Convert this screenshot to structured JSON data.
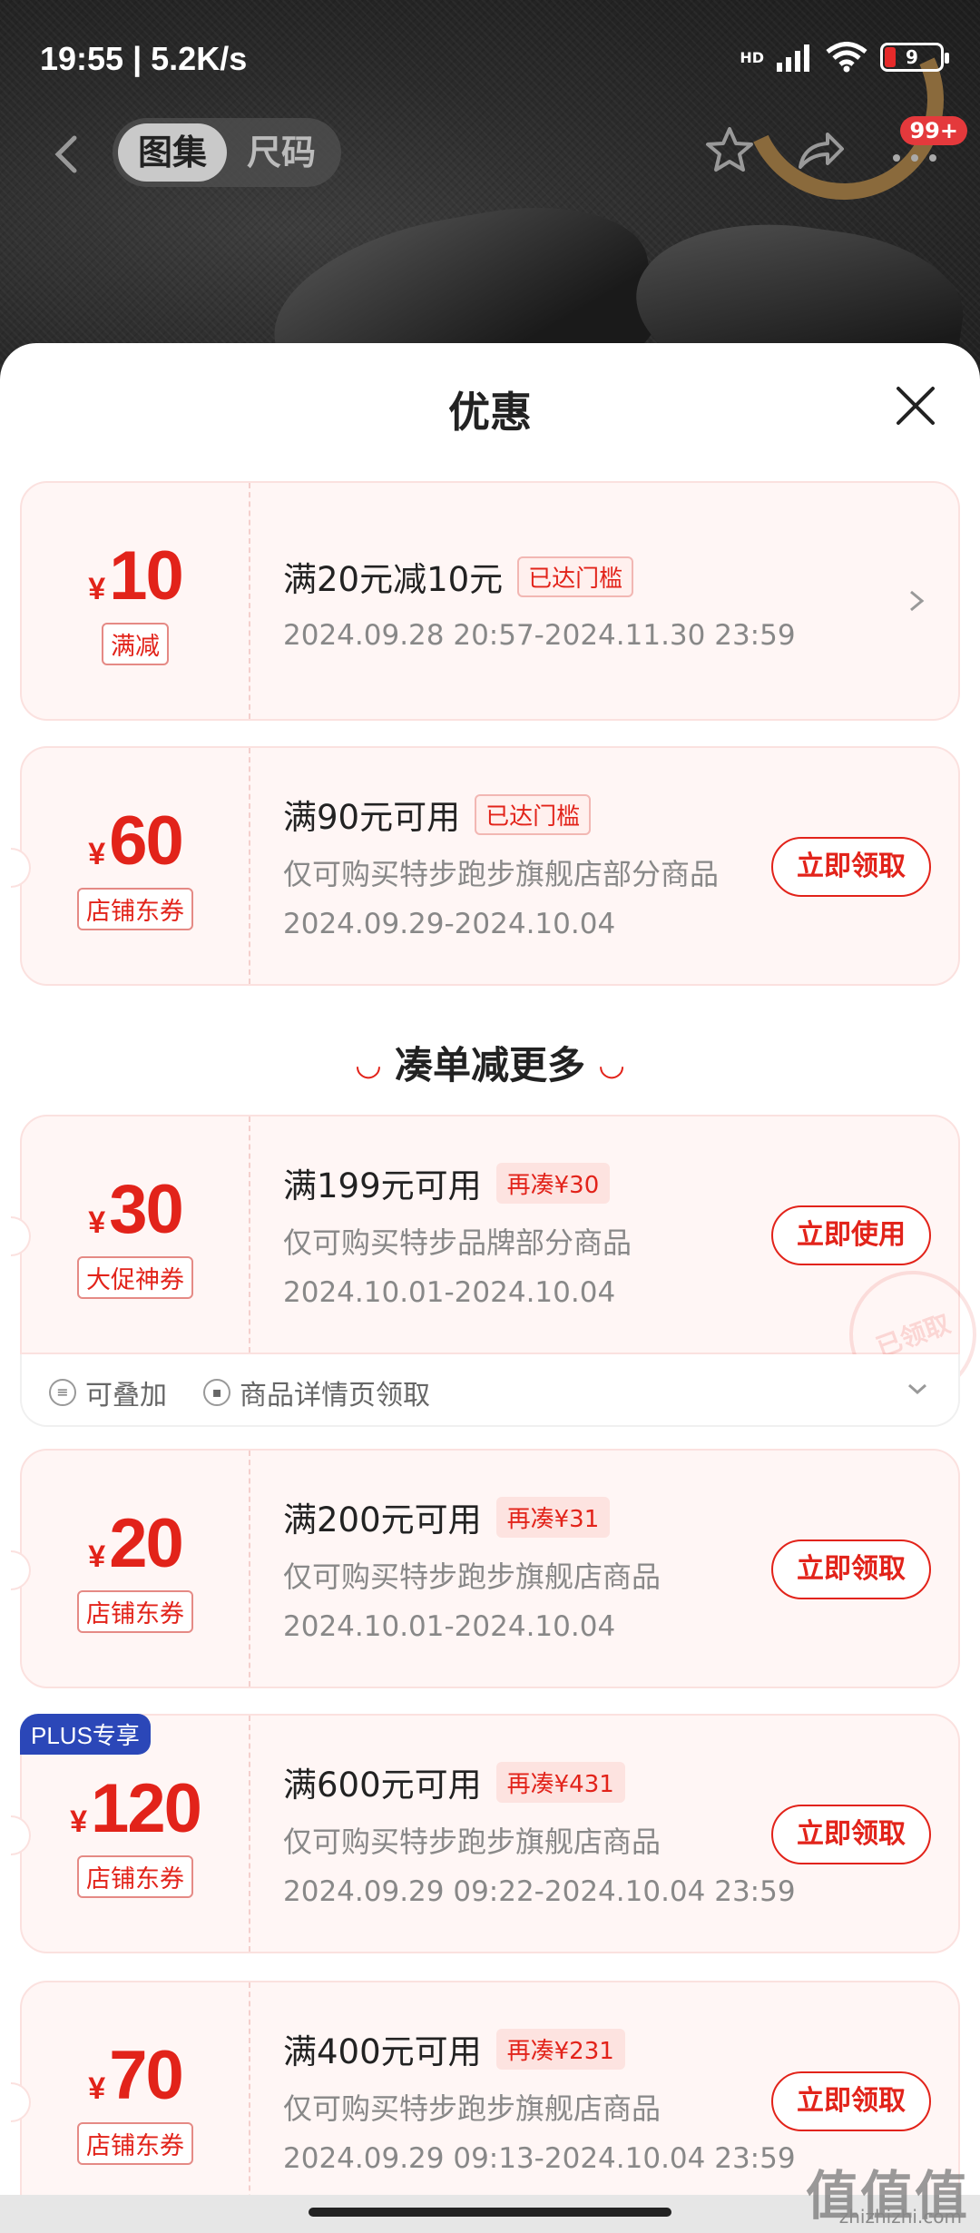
{
  "status": {
    "time": "19:55 | 5.2K/s",
    "hd": "HD",
    "battery": "9"
  },
  "top_nav": {
    "tabs": [
      "图集",
      "尺码"
    ],
    "badge": "99+"
  },
  "sheet": {
    "title": "优惠"
  },
  "coupons": [
    {
      "currency": "¥",
      "amount": "10",
      "type": "满减",
      "title": "满20元减10元",
      "status": "已达门槛",
      "desc": "",
      "date": "2024.09.28 20:57-2024.11.30 23:59",
      "action": ""
    },
    {
      "currency": "¥",
      "amount": "60",
      "type": "店铺东券",
      "title": "满90元可用",
      "status": "已达门槛",
      "desc": "仅可购买特步跑步旗舰店部分商品",
      "date": "2024.09.29-2024.10.04",
      "action": "立即领取"
    }
  ],
  "section": {
    "title": "凑单减更多",
    "left_mark": "◡",
    "right_mark": "◡"
  },
  "more_coupons": [
    {
      "currency": "¥",
      "amount": "30",
      "type": "大促神券",
      "title": "满199元可用",
      "status": "再凑¥30",
      "desc": "仅可购买特步品牌部分商品",
      "date": "2024.10.01-2024.10.04",
      "action": "立即使用",
      "stamp": "已领取",
      "extras": [
        "可叠加",
        "商品详情页领取"
      ]
    },
    {
      "currency": "¥",
      "amount": "20",
      "type": "店铺东券",
      "title": "满200元可用",
      "status": "再凑¥31",
      "desc": "仅可购买特步跑步旗舰店商品",
      "date": "2024.10.01-2024.10.04",
      "action": "立即领取"
    },
    {
      "badge": "PLUS专享",
      "currency": "¥",
      "amount": "120",
      "type": "店铺东券",
      "title": "满600元可用",
      "status": "再凑¥431",
      "desc": "仅可购买特步跑步旗舰店商品",
      "date": "2024.09.29 09:22-2024.10.04 23:59",
      "action": "立即领取"
    },
    {
      "currency": "¥",
      "amount": "70",
      "type": "店铺东券",
      "title": "满400元可用",
      "status": "再凑¥231",
      "desc": "仅可购买特步跑步旗舰店商品",
      "date": "2024.09.29 09:13-2024.10.04 23:59",
      "action": "立即领取"
    }
  ],
  "watermark": {
    "main": "值值值",
    "sub": "zhizhizhi.com"
  },
  "colors": {
    "accent": "#e2231a",
    "plus": "#2b47b8",
    "coupon_bg": "#fff6f5"
  },
  "icons": [
    "back-icon",
    "star-icon",
    "share-icon",
    "more-icon",
    "close-icon",
    "chevron-right-icon",
    "chevron-down-icon"
  ]
}
